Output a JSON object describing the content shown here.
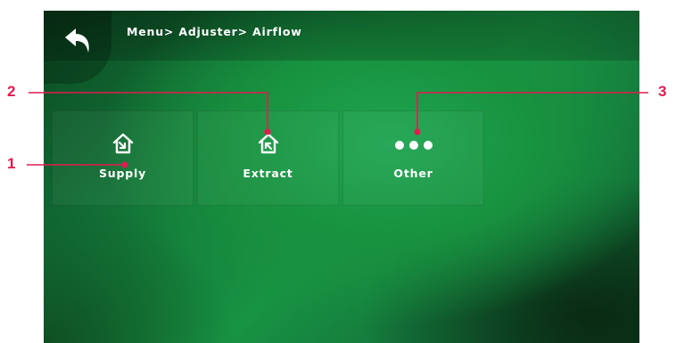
{
  "header": {
    "breadcrumb": "Menu> Adjuster> Airflow",
    "back_icon": "back-arrow-icon"
  },
  "tiles": [
    {
      "label": "Supply",
      "icon": "house-arrow-in-icon"
    },
    {
      "label": "Extract",
      "icon": "house-arrow-out-icon"
    },
    {
      "label": "Other",
      "icon": "three-dots-icon"
    }
  ],
  "callouts": [
    "1",
    "2",
    "3"
  ],
  "colors": {
    "callout": "#e31a50",
    "background": "#15893f",
    "text": "#ffffff"
  }
}
